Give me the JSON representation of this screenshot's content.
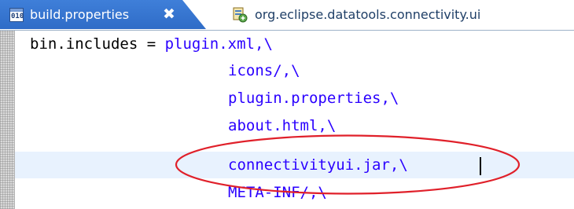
{
  "tabs": [
    {
      "label": "build.properties",
      "icon": "properties-file-icon",
      "active": true,
      "close_glyph": "✖"
    },
    {
      "label": "org.eclipse.datatools.connectivity.ui",
      "icon": "plugin-manifest-icon",
      "active": false
    }
  ],
  "editor": {
    "key": "bin.includes",
    "separator": " = ",
    "values": [
      "plugin.xml,\\",
      "icons/,\\",
      "plugin.properties,\\",
      "about.html,\\",
      "connectivityui.jar,\\",
      "META-INF/,\\"
    ],
    "highlighted_value": "connectivityui.jar,\\",
    "colors": {
      "key": "#000000",
      "value": "#2a00ff",
      "current_line": "#e8f2fe",
      "annotation": "#e0202a",
      "active_tab": "#3a78d4"
    }
  }
}
